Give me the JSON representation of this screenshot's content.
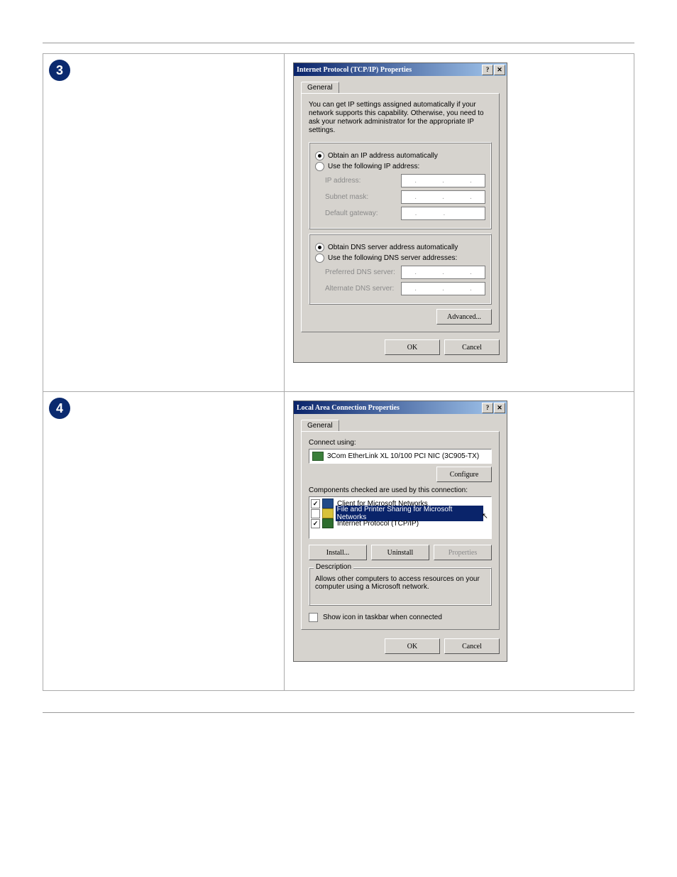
{
  "steps": {
    "s3": "3",
    "s4": "4"
  },
  "dlg1": {
    "title": "Internet Protocol (TCP/IP) Properties",
    "help_btn": "?",
    "close_btn": "✕",
    "tab": "General",
    "info": "You can get IP settings assigned automatically if your network supports this capability. Otherwise, you need to ask your network administrator for the appropriate IP settings.",
    "r_auto_ip": "Obtain an IP address automatically",
    "r_use_ip": "Use the following IP address:",
    "ip_label": "IP address:",
    "subnet_label": "Subnet mask:",
    "gateway_label": "Default gateway:",
    "r_auto_dns": "Obtain DNS server address automatically",
    "r_use_dns": "Use the following DNS server addresses:",
    "pref_dns_label": "Preferred DNS server:",
    "alt_dns_label": "Alternate DNS server:",
    "advanced": "Advanced...",
    "ok": "OK",
    "cancel": "Cancel"
  },
  "dlg2": {
    "title": "Local Area Connection Properties",
    "help_btn": "?",
    "close_btn": "✕",
    "tab": "General",
    "connect_using": "Connect using:",
    "adapter": "3Com EtherLink XL 10/100 PCI NIC (3C905-TX)",
    "configure": "Configure",
    "components_label": "Components checked are used by this connection:",
    "items": [
      {
        "checked": true,
        "selected": false,
        "icon": "client",
        "label": "Client for Microsoft Networks"
      },
      {
        "checked": false,
        "selected": true,
        "icon": "share",
        "label": "File and Printer Sharing for Microsoft Networks"
      },
      {
        "checked": true,
        "selected": false,
        "icon": "proto",
        "label": "Internet Protocol (TCP/IP)"
      }
    ],
    "install": "Install...",
    "uninstall": "Uninstall",
    "properties": "Properties",
    "desc_legend": "Description",
    "desc_text": "Allows other computers to access resources on your computer using a Microsoft network.",
    "show_icon": "Show icon in taskbar when connected",
    "ok": "OK",
    "cancel": "Cancel"
  },
  "footer": {
    "page": ""
  }
}
